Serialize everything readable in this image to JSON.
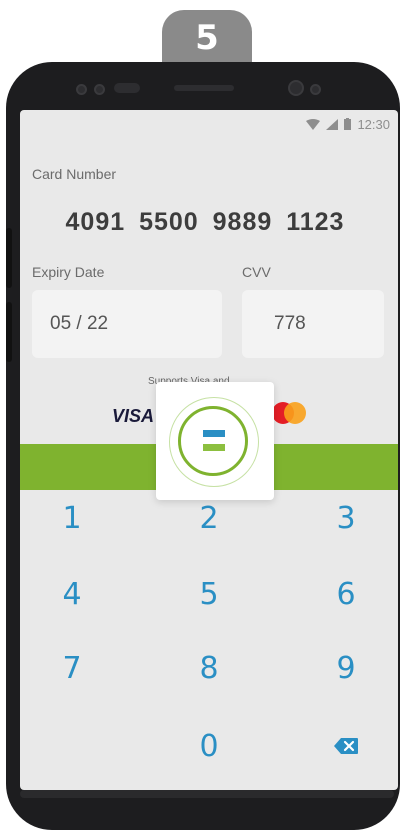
{
  "step_badge": "5",
  "status_bar": {
    "time": "12:30",
    "icons": [
      "wifi-icon",
      "signal-icon",
      "battery-icon"
    ]
  },
  "card": {
    "number_label": "Card Number",
    "number_value": "4091 5500 9889 1123",
    "expiry_label": "Expiry Date",
    "expiry_value": "05 / 22",
    "cvv_label": "CVV",
    "cvv_value": "778"
  },
  "supports": {
    "text": "Supports Visa and",
    "visa_text": "VISA"
  },
  "keypad": {
    "keys": [
      "1",
      "2",
      "3",
      "4",
      "5",
      "6",
      "7",
      "8",
      "9",
      "0"
    ],
    "delete": "x"
  },
  "colors": {
    "accent_green": "#7fb32f",
    "key_blue": "#2a8fc4",
    "screen_bg": "#e9e9e9"
  },
  "modal": {
    "icon": "equals-icon"
  }
}
